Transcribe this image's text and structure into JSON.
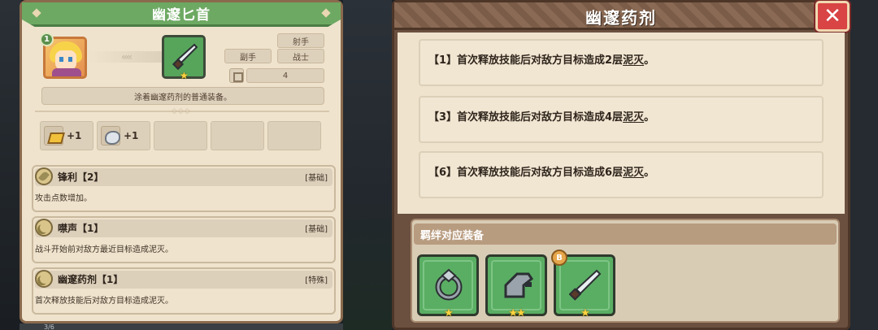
{
  "left_panel": {
    "title": "幽邃匕首",
    "level": "1",
    "tags": {
      "class1": "射手",
      "slot": "副手",
      "class2": "战士",
      "count": "4"
    },
    "description": "涂着幽邃药剂的普通装备。",
    "materials": [
      {
        "icon": "gold-ingot-icon",
        "amount": "+1"
      },
      {
        "icon": "stone-icon",
        "amount": "+1"
      }
    ],
    "skills": [
      {
        "icon": "leaf-icon",
        "name": "锋利【2】",
        "type": "[基础]",
        "desc": "攻击点数增加。"
      },
      {
        "icon": "moon-icon",
        "name": "噤声【1】",
        "type": "[基础]",
        "desc": "战斗开始前对敌方最近目标造成泥灭。"
      },
      {
        "icon": "moon-icon",
        "name": "幽邃药剂【1】",
        "type": "[特殊]",
        "desc": "首次释放技能后对敌方目标造成泥灭。"
      }
    ],
    "footer_peek": "3/6"
  },
  "right_panel": {
    "title": "幽邃药剂",
    "close_label": "✕",
    "effects": [
      {
        "prefix": "【1】首次释放技能后对敌方目标造成2层",
        "keyword": "泥灭",
        "suffix": "。"
      },
      {
        "prefix": "【3】首次释放技能后对敌方目标造成4层",
        "keyword": "泥灭",
        "suffix": "。"
      },
      {
        "prefix": "【6】首次释放技能后对敌方目标造成6层",
        "keyword": "泥灭",
        "suffix": "。"
      }
    ],
    "bond_label": "羁绊对应装备",
    "equipment": [
      {
        "icon": "ring-icon",
        "stars": "★"
      },
      {
        "icon": "gauntlet-icon",
        "stars": "★★"
      },
      {
        "icon": "dagger-icon",
        "stars": "★",
        "badge": "B"
      }
    ]
  },
  "colors": {
    "header_green": "#6da962",
    "parchment": "#efe3cd",
    "slot_green": "#5aae63",
    "close_red": "#d94444",
    "star_gold": "#ffd23f"
  }
}
